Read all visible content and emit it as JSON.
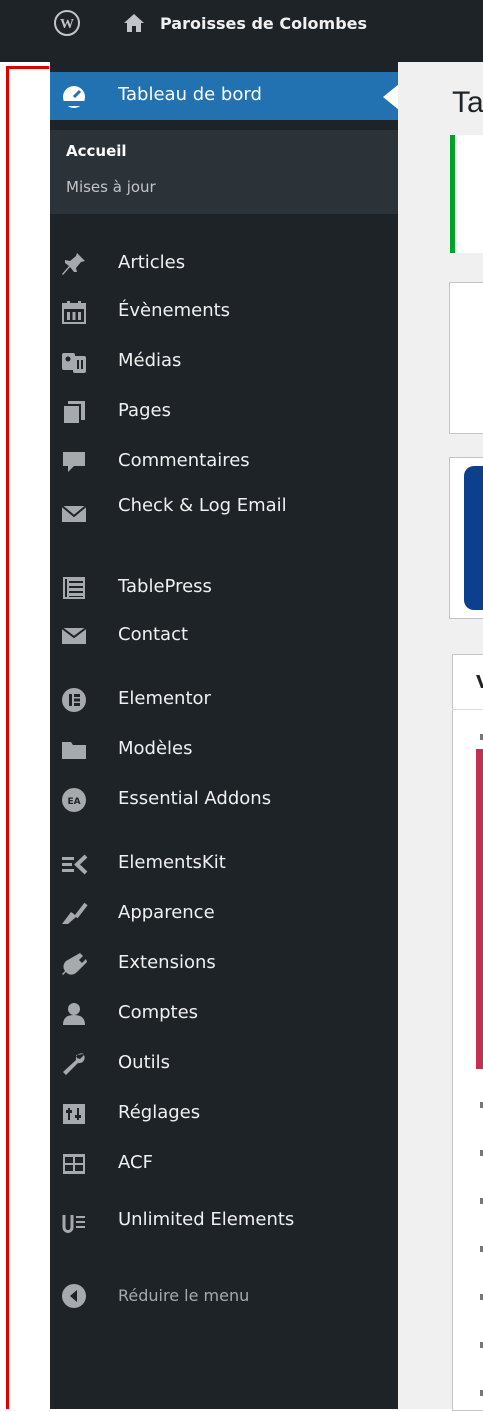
{
  "adminbar": {
    "site_name": "Paroisses de Colombes"
  },
  "sidebar": {
    "items": [
      {
        "label": "Tableau de bord",
        "icon": "dashboard-icon",
        "active": true
      },
      {
        "label": "Articles",
        "icon": "pushpin-icon"
      },
      {
        "label": "Évènements",
        "icon": "calendar-icon"
      },
      {
        "label": "Médias",
        "icon": "media-icon"
      },
      {
        "label": "Pages",
        "icon": "pages-icon"
      },
      {
        "label": "Commentaires",
        "icon": "comment-icon"
      },
      {
        "label": "Check & Log Email",
        "icon": "email-icon"
      },
      {
        "label": "TablePress",
        "icon": "table-icon"
      },
      {
        "label": "Contact",
        "icon": "envelope-icon"
      },
      {
        "label": "Elementor",
        "icon": "elementor-icon"
      },
      {
        "label": "Modèles",
        "icon": "folder-icon"
      },
      {
        "label": "Essential Addons",
        "icon": "essential-addons-icon"
      },
      {
        "label": "ElementsKit",
        "icon": "elementskit-icon"
      },
      {
        "label": "Apparence",
        "icon": "paintbrush-icon"
      },
      {
        "label": "Extensions",
        "icon": "plugin-icon"
      },
      {
        "label": "Comptes",
        "icon": "users-icon"
      },
      {
        "label": "Outils",
        "icon": "wrench-icon"
      },
      {
        "label": "Réglages",
        "icon": "settings-icon"
      },
      {
        "label": "ACF",
        "icon": "acf-icon"
      },
      {
        "label": "Unlimited Elements",
        "icon": "unlimited-elements-icon"
      }
    ],
    "submenu": [
      {
        "label": "Accueil",
        "current": true
      },
      {
        "label": "Mises à jour",
        "current": false
      }
    ],
    "collapse_label": "Réduire le menu"
  },
  "content": {
    "title": "Ta",
    "tab_label": "V"
  },
  "colors": {
    "sidebar_bg": "#1d2327",
    "active_bg": "#2271b1",
    "submenu_bg": "#2c3338",
    "annotation_red": "#e00000"
  }
}
